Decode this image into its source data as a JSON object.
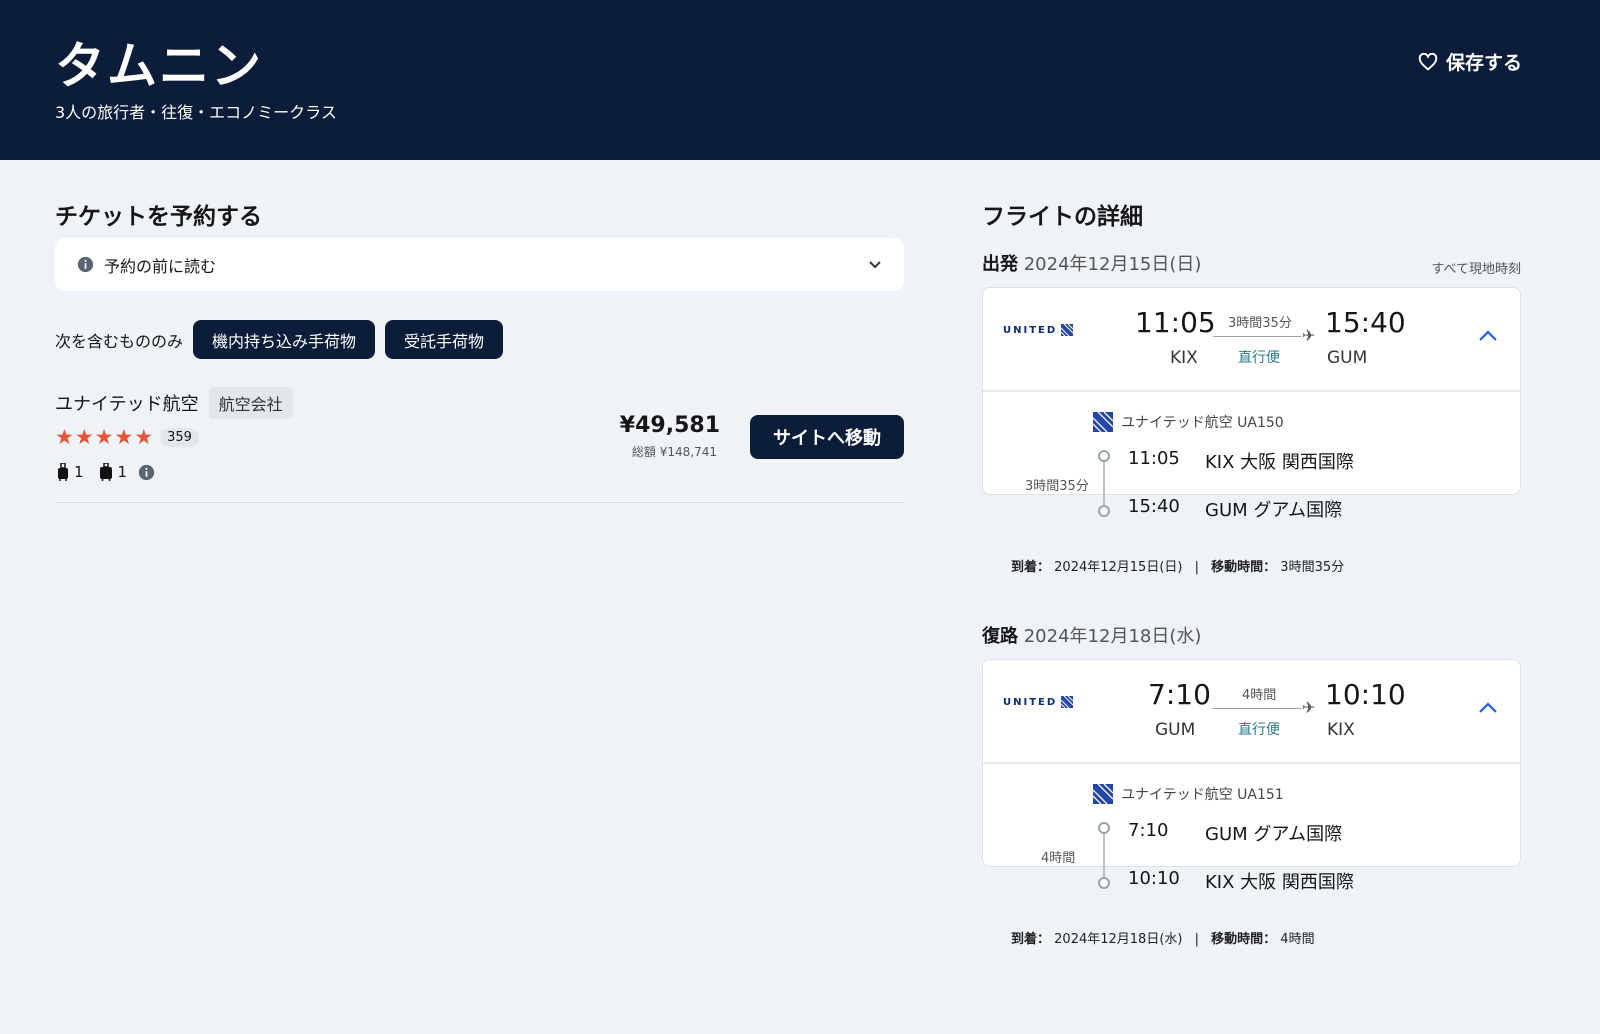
{
  "header": {
    "title": "タムニン",
    "subtitle": "3人の旅行者・往復・エコノミークラス",
    "save_label": "保存する"
  },
  "booking": {
    "section_title": "チケットを予約する",
    "info_label": "予約の前に読む",
    "filter_label": "次を含むもののみ",
    "filters": [
      "機内持ち込み手荷物",
      "受託手荷物"
    ],
    "provider_name": "ユナイテッド航空",
    "provider_tag": "航空会社",
    "rating_count": "359",
    "rating_stars": 5,
    "carry_on_count": "1",
    "checked_count": "1",
    "price": "¥49,581",
    "total": "総額 ¥148,741",
    "button_label": "サイトへ移動"
  },
  "details": {
    "section_title": "フライトの詳細",
    "local_time_note": "すべて現地時刻",
    "outbound": {
      "label": "出発",
      "date": "2024年12月15日(日)",
      "logo_text": "UNITED",
      "dep_time": "11:05",
      "dep_code": "KIX",
      "arr_time": "15:40",
      "arr_code": "GUM",
      "duration": "3時間35分",
      "direct": "直行便",
      "airline_flight": "ユナイテッド航空 UA150",
      "segment_duration": "3時間35分",
      "seg_dep_time": "11:05",
      "seg_dep_airport": "KIX 大阪 関西国際",
      "seg_arr_time": "15:40",
      "seg_arr_airport": "GUM グアム国際",
      "arrive_label": "到着：",
      "arrive_date": "2024年12月15日(日)",
      "sep": "|",
      "travel_label": "移動時間：",
      "travel_time": "3時間35分"
    },
    "return": {
      "label": "復路",
      "date": "2024年12月18日(水)",
      "logo_text": "UNITED",
      "dep_time": "7:10",
      "dep_code": "GUM",
      "arr_time": "10:10",
      "arr_code": "KIX",
      "duration": "4時間",
      "direct": "直行便",
      "airline_flight": "ユナイテッド航空 UA151",
      "segment_duration": "4時間",
      "seg_dep_time": "7:10",
      "seg_dep_airport": "GUM グアム国際",
      "seg_arr_time": "10:10",
      "seg_arr_airport": "KIX 大阪 関西国際",
      "arrive_label": "到着：",
      "arrive_date": "2024年12月18日(水)",
      "sep": "|",
      "travel_label": "移動時間：",
      "travel_time": "4時間"
    }
  },
  "colors": {
    "header_bg": "#0c1d3a",
    "star": "#e4563a",
    "direct_text": "#2a7b8c",
    "chevron": "#1f5fd6"
  }
}
